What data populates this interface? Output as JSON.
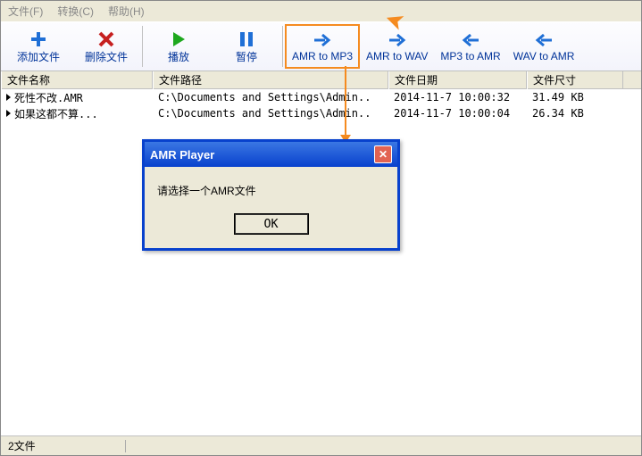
{
  "menu": {
    "file": "文件(F)",
    "convert": "转换(C)",
    "help": "帮助(H)"
  },
  "toolbar": {
    "add": "添加文件",
    "del": "删除文件",
    "play": "播放",
    "pause": "暂停",
    "amr_mp3": "AMR to MP3",
    "amr_wav": "AMR to WAV",
    "mp3_amr": "MP3 to AMR",
    "wav_amr": "WAV to AMR"
  },
  "columns": {
    "name": "文件名称",
    "path": "文件路径",
    "date": "文件日期",
    "size": "文件尺寸"
  },
  "rows": [
    {
      "name": "死性不改.AMR",
      "path": "C:\\Documents and Settings\\Admin..",
      "date": "2014-11-7 10:00:32",
      "size": "31.49 KB"
    },
    {
      "name": "如果这都不算...",
      "path": "C:\\Documents and Settings\\Admin..",
      "date": "2014-11-7 10:00:04",
      "size": "26.34 KB"
    }
  ],
  "dialog": {
    "title": "AMR Player",
    "message": "请选择一个AMR文件",
    "ok": "OK"
  },
  "status": {
    "count": "2文件"
  }
}
